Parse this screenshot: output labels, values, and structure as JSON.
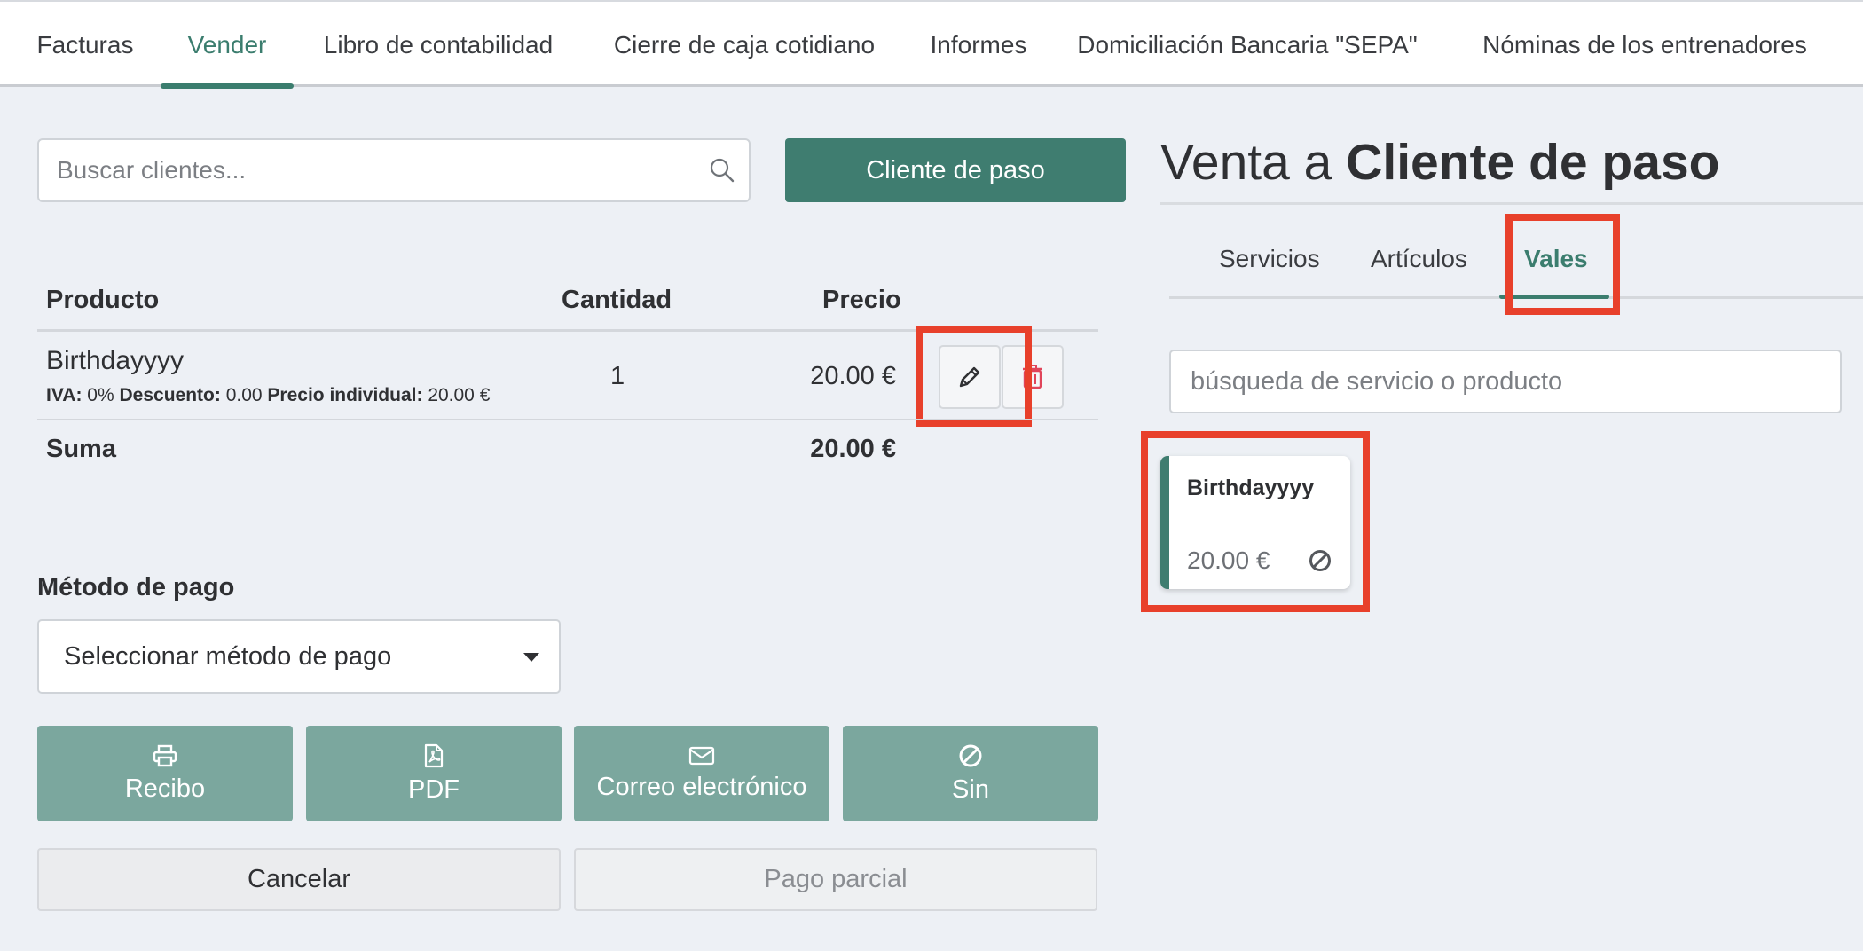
{
  "nav": {
    "tabs": [
      {
        "label": "Facturas"
      },
      {
        "label": "Vender"
      },
      {
        "label": "Libro de contabilidad"
      },
      {
        "label": "Cierre de caja cotidiano"
      },
      {
        "label": "Informes"
      },
      {
        "label": "Domiciliación Bancaria \"SEPA\""
      },
      {
        "label": "Nóminas de los entrenadores"
      }
    ],
    "active_tab": "Vender"
  },
  "client_search": {
    "placeholder": "Buscar clientes...",
    "value": ""
  },
  "walk_in_button": "Cliente de paso",
  "cart": {
    "headers": {
      "product": "Producto",
      "quantity": "Cantidad",
      "price": "Precio"
    },
    "items": [
      {
        "name": "Birthdayyyy",
        "vat_label": "IVA:",
        "vat_value": "0%",
        "discount_label": "Descuento:",
        "discount_value": "0.00",
        "unit_price_label": "Precio individual:",
        "unit_price_value": "20.00 €",
        "quantity": "1",
        "price": "20.00 €"
      }
    ],
    "sum_label": "Suma",
    "sum_value": "20.00 €"
  },
  "payment": {
    "label": "Método de pago",
    "select_value": "Seleccionar método de pago",
    "buttons": [
      {
        "label": "Recibo",
        "icon": "printer-icon"
      },
      {
        "label": "PDF",
        "icon": "pdf-file-icon"
      },
      {
        "label": "Correo electrónico",
        "icon": "envelope-icon"
      },
      {
        "label": "Sin",
        "icon": "ban-icon"
      }
    ],
    "cancel_label": "Cancelar",
    "partial_label": "Pago parcial"
  },
  "sale": {
    "title_prefix": "Venta a",
    "title_client": "Cliente de paso",
    "tabs": [
      {
        "label": "Servicios"
      },
      {
        "label": "Artículos"
      },
      {
        "label": "Vales"
      }
    ],
    "active_tab": "Vales",
    "search_placeholder": "búsqueda de servicio o producto",
    "products": [
      {
        "name": "Birthdayyyy",
        "price": "20.00 €",
        "icon": "ban-icon"
      }
    ]
  },
  "colors": {
    "accent": "#3f7d70",
    "accent_light": "#7ba79e",
    "highlight": "#e8402b",
    "background": "#edf0f5",
    "delete": "#e0455a"
  }
}
